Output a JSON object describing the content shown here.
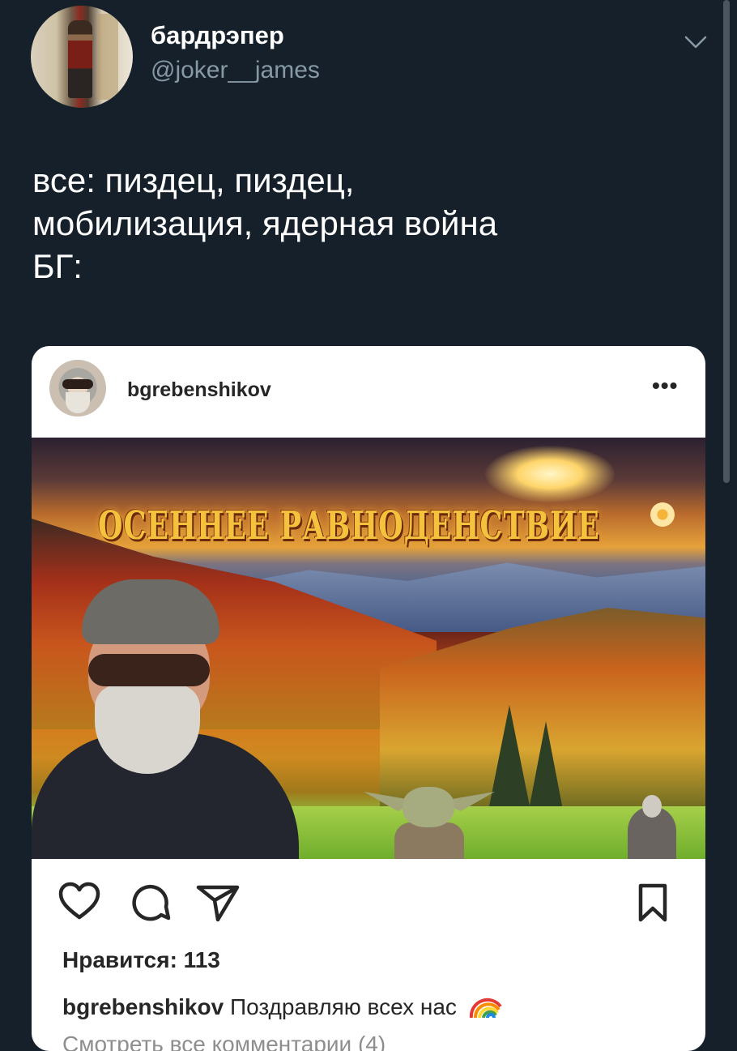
{
  "tweet": {
    "author_name": "бардрэпер",
    "author_handle": "@joker__james",
    "text_lines": [
      "все: пиздец, пиздец,",
      "мобилизация, ядерная война",
      "БГ:"
    ]
  },
  "instagram_post": {
    "username": "bgrebenshikov",
    "more_label": "•••",
    "image_title": "ОСЕННЕЕ РАВНОДЕНСТВИЕ",
    "likes": "Нравится: 113",
    "caption_user": "bgrebenshikov",
    "caption_text": "Поздравляю всех нас",
    "comments_link": "Смотреть все комментарии (4)"
  },
  "icons": {
    "more": "chevron-down-icon",
    "like": "heart-icon",
    "comment": "comment-icon",
    "share": "send-icon",
    "save": "bookmark-icon",
    "caption_emoji": "rainbow-icon"
  },
  "colors": {
    "background": "#15202b",
    "secondary_text": "#8899a6",
    "card_background": "#ffffff"
  }
}
